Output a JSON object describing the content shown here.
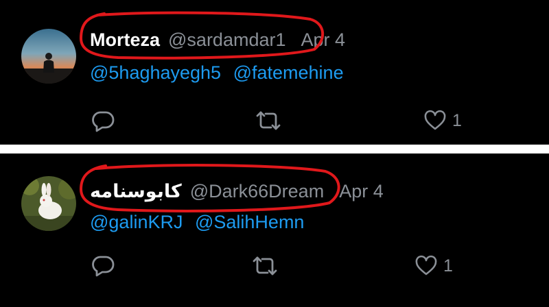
{
  "tweets": [
    {
      "display_name": "Morteza",
      "handle": "@sardamdar1",
      "date": "Apr 4",
      "mentions": [
        "@5haghayegh5",
        "@fatemehine"
      ],
      "like_count": "1"
    },
    {
      "display_name": "کابوسنامه",
      "handle": "@Dark66Dream",
      "date": "Apr 4",
      "mentions": [
        "@galinKRJ",
        "@SalihHemn"
      ],
      "like_count": "1"
    }
  ],
  "colors": {
    "background": "#000000",
    "name": "#ffffff",
    "secondary_text": "#8b9097",
    "link": "#1d9bf0",
    "highlight_annotation": "#e0181b"
  },
  "icons": {
    "reply": "speech-bubble-icon",
    "retweet": "retweet-arrows-icon",
    "like": "heart-outline-icon"
  }
}
